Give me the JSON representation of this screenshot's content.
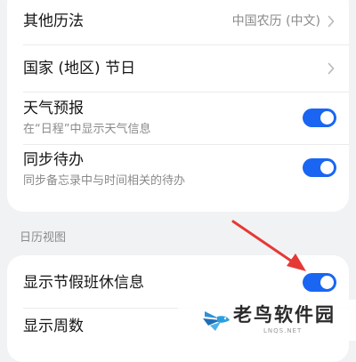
{
  "calendar_settings": {
    "items": [
      {
        "title": "其他历法",
        "value": "中国农历 (中文)"
      },
      {
        "title": "国家 (地区) 节日"
      },
      {
        "title": "天气预报",
        "subtitle": "在“日程”中显示天气信息",
        "enabled": true
      },
      {
        "title": "同步待办",
        "subtitle": "同步备忘录中与时间相关的待办",
        "enabled": true
      }
    ]
  },
  "calendar_view": {
    "header": "日历视图",
    "items": [
      {
        "title": "显示节假班休信息",
        "enabled": true
      },
      {
        "title": "显示周数"
      }
    ]
  },
  "colors": {
    "background": "#f1f2f4",
    "card": "#ffffff",
    "toggle_on": "#1a66f2",
    "annotation_arrow": "#e53935"
  },
  "watermark": {
    "text": "老鸟软件园",
    "url": "LNQS.NET"
  }
}
